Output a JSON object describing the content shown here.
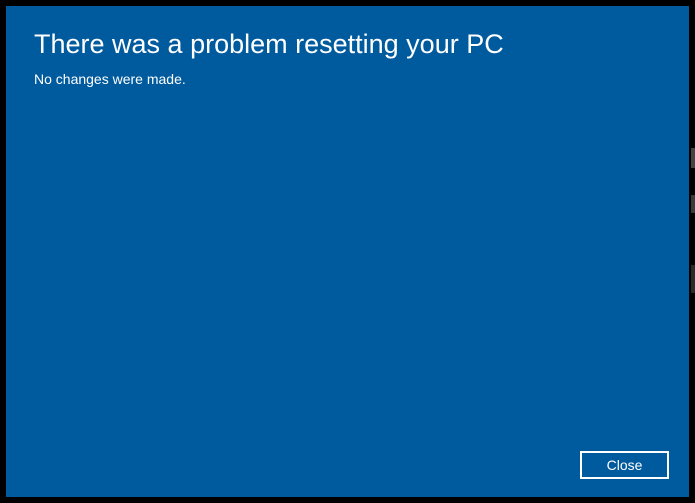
{
  "dialog": {
    "title": "There was a problem resetting your PC",
    "message": "No changes were made.",
    "close_label": "Close"
  }
}
